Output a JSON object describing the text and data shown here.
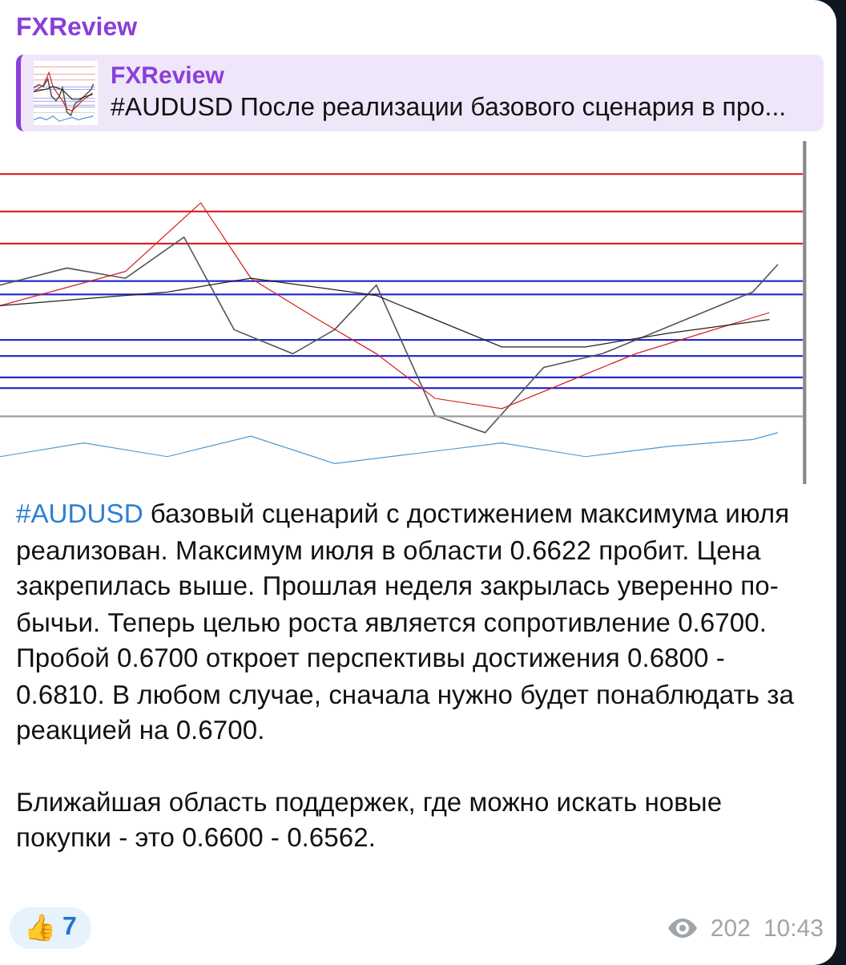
{
  "channel": {
    "name": "FXReview"
  },
  "reply": {
    "name": "FXReview",
    "text": "#AUDUSD После реализации базового сценария в про..."
  },
  "paragraphs": [
    {
      "hashtag": "#AUDUSD",
      "text": " базовый сценарий с достижением максимума июля реализован. Максимум июля в области 0.6622 пробит. Цена закрепилась выше. Прошлая неделя закрылась уверенно по-бычьи. Теперь целью роста является сопротивление 0.6700. Пробой 0.6700 откроет перспективы достижения 0.6800 - 0.6810. В любом случае, сначала нужно будет понаблюдать за реакцией на 0.6700."
    },
    {
      "text": "Ближайшая область поддержек, где можно искать новые покупки - это 0.6600 - 0.6562."
    }
  ],
  "reactions": [
    {
      "emoji": "👍",
      "count": "7",
      "selected": false
    }
  ],
  "views": "202",
  "time": "10:43"
}
